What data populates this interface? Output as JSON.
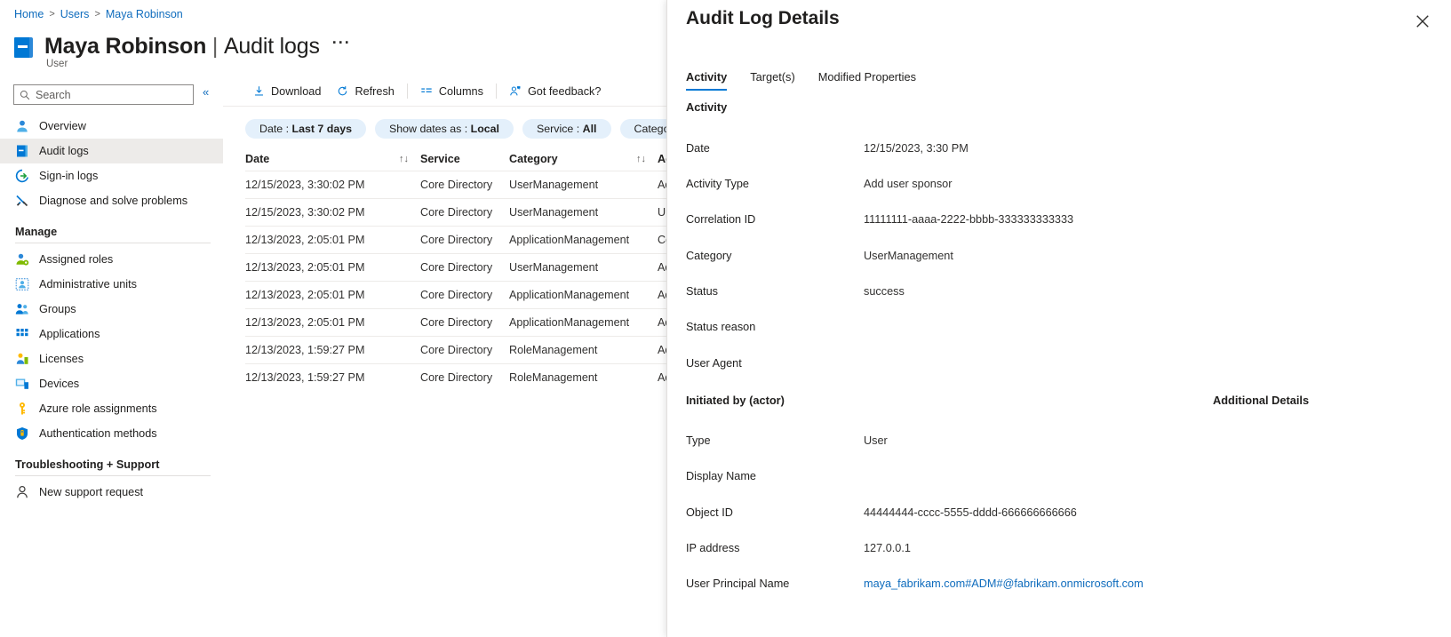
{
  "breadcrumb": {
    "items": [
      "Home",
      "Users",
      "Maya Robinson"
    ],
    "separator": ">"
  },
  "header": {
    "icon": "user-book-icon",
    "title": "Maya Robinson",
    "title_separator": "|",
    "title_suffix": "Audit logs",
    "more_label": "···",
    "subtitle": "User"
  },
  "search": {
    "placeholder": "Search",
    "value": "",
    "icon": "search-icon"
  },
  "collapse": {
    "label": "«"
  },
  "sidebar": {
    "items": [
      {
        "label": "Overview",
        "icon": "user-icon",
        "selected": false
      },
      {
        "label": "Audit logs",
        "icon": "book-icon",
        "selected": true
      },
      {
        "label": "Sign-in logs",
        "icon": "signin-arrow-icon",
        "selected": false
      },
      {
        "label": "Diagnose and solve problems",
        "icon": "wrench-icon",
        "selected": false
      }
    ],
    "groups": [
      {
        "title": "Manage",
        "items": [
          {
            "label": "Assigned roles",
            "icon": "assigned-roles-icon"
          },
          {
            "label": "Administrative units",
            "icon": "administrative-units-icon"
          },
          {
            "label": "Groups",
            "icon": "groups-icon"
          },
          {
            "label": "Applications",
            "icon": "applications-grid-icon"
          },
          {
            "label": "Licenses",
            "icon": "licenses-icon"
          },
          {
            "label": "Devices",
            "icon": "devices-icon"
          },
          {
            "label": "Azure role assignments",
            "icon": "key-icon"
          },
          {
            "label": "Authentication methods",
            "icon": "shield-icon"
          }
        ]
      },
      {
        "title": "Troubleshooting + Support",
        "items": [
          {
            "label": "New support request",
            "icon": "support-person-icon"
          }
        ]
      }
    ]
  },
  "toolbar": {
    "download_label": "Download",
    "download_icon": "download-icon",
    "refresh_label": "Refresh",
    "refresh_icon": "refresh-icon",
    "columns_label": "Columns",
    "columns_icon": "columns-icon",
    "feedback_label": "Got feedback?",
    "feedback_icon": "feedback-person-icon"
  },
  "filters": [
    {
      "name": "Date",
      "value": "Last 7 days"
    },
    {
      "name": "Show dates as",
      "value": "Local"
    },
    {
      "name": "Service",
      "value": "All"
    },
    {
      "name": "Category",
      "value": ""
    }
  ],
  "table": {
    "columns": [
      "Date",
      "Service",
      "Category",
      "Activity"
    ],
    "sort_icon": "sort-updown-icon",
    "rows": [
      {
        "date": "12/15/2023, 3:30:02 PM",
        "service": "Core Directory",
        "category": "UserManagement",
        "activity": "Add"
      },
      {
        "date": "12/15/2023, 3:30:02 PM",
        "service": "Core Directory",
        "category": "UserManagement",
        "activity": "Upda"
      },
      {
        "date": "12/13/2023, 2:05:01 PM",
        "service": "Core Directory",
        "category": "ApplicationManagement",
        "activity": "Cons"
      },
      {
        "date": "12/13/2023, 2:05:01 PM",
        "service": "Core Directory",
        "category": "UserManagement",
        "activity": "Add"
      },
      {
        "date": "12/13/2023, 2:05:01 PM",
        "service": "Core Directory",
        "category": "ApplicationManagement",
        "activity": "Add"
      },
      {
        "date": "12/13/2023, 2:05:01 PM",
        "service": "Core Directory",
        "category": "ApplicationManagement",
        "activity": "Add"
      },
      {
        "date": "12/13/2023, 1:59:27 PM",
        "service": "Core Directory",
        "category": "RoleManagement",
        "activity": "Add"
      },
      {
        "date": "12/13/2023, 1:59:27 PM",
        "service": "Core Directory",
        "category": "RoleManagement",
        "activity": "Add"
      }
    ]
  },
  "panel": {
    "title": "Audit Log Details",
    "close_icon": "close-icon",
    "tabs": [
      {
        "label": "Activity",
        "active": true
      },
      {
        "label": "Target(s)",
        "active": false
      },
      {
        "label": "Modified Properties",
        "active": false
      }
    ],
    "activity_section": "Activity",
    "activity_fields": [
      {
        "label": "Date",
        "value": "12/15/2023, 3:30 PM"
      },
      {
        "label": "Activity Type",
        "value": "Add user sponsor"
      },
      {
        "label": "Correlation ID",
        "value": "11111111-aaaa-2222-bbbb-333333333333"
      },
      {
        "label": "Category",
        "value": "UserManagement"
      },
      {
        "label": "Status",
        "value": "success"
      },
      {
        "label": "Status reason",
        "value": ""
      },
      {
        "label": "User Agent",
        "value": ""
      }
    ],
    "actor_section": "Initiated by (actor)",
    "additional_details_section": "Additional Details",
    "actor_fields": [
      {
        "label": "Type",
        "value": "User",
        "link": false
      },
      {
        "label": "Display Name",
        "value": "",
        "link": false
      },
      {
        "label": "Object ID",
        "value": "44444444-cccc-5555-dddd-666666666666",
        "link": false
      },
      {
        "label": "IP address",
        "value": "127.0.0.1",
        "link": false
      },
      {
        "label": "User Principal Name",
        "value": "maya_fabrikam.com#ADM#@fabrikam.onmicrosoft.com",
        "link": true
      }
    ]
  },
  "colors": {
    "accent": "#0078d4",
    "link": "#0f6cbd",
    "chip_bg": "#e4f0fb",
    "selected_bg": "#edebe9",
    "border": "#e1dfdd"
  }
}
